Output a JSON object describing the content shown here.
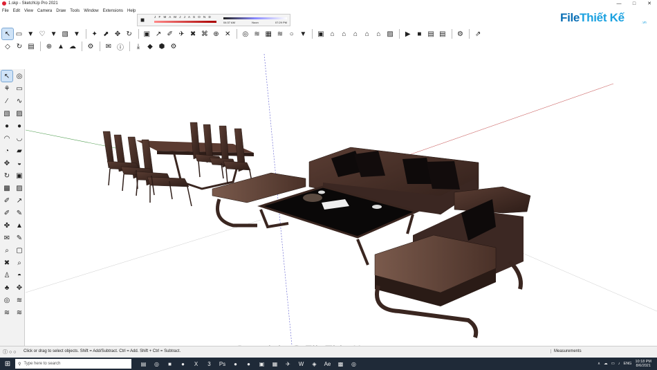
{
  "window": {
    "title": "1.skp - SketchUp Pro 2021",
    "minimize": "—",
    "maximize": "□",
    "close": "✕"
  },
  "menu": [
    "File",
    "Edit",
    "View",
    "Camera",
    "Draw",
    "Tools",
    "Window",
    "Extensions",
    "Help"
  ],
  "shadow": {
    "months": "J F M A M J J A S O N D",
    "time_start": "04:37 AM",
    "time_mid": "Noon",
    "time_end": "07:29 PM"
  },
  "logo": {
    "brand_a": "File",
    "brand_b": "Thiết Kế",
    "suffix": ".vn"
  },
  "toolbar1": [
    "↖",
    "▭",
    "▼",
    "♡",
    "▼",
    "▧",
    "▼",
    "✦",
    "⬈",
    "✥",
    "↻",
    "▣",
    "↗",
    "✐",
    "✈",
    "✖",
    "⌘",
    "⊕",
    "✕",
    "◎",
    "≋",
    "▦",
    "≋",
    "○",
    "▼",
    "▣",
    "⌂",
    "⌂",
    "⌂",
    "⌂",
    "⌂",
    "▨",
    "▶",
    "■",
    "▤",
    "▤",
    "⚙",
    "⇗"
  ],
  "toolbar2": [
    "◇",
    "↻",
    "▤",
    "⊕",
    "▲",
    "☁",
    "⚙",
    "✉",
    "ⓘ",
    "⤓",
    "◆",
    "⬢",
    "⚙"
  ],
  "leftbar": [
    "↖",
    "◎",
    "⚘",
    "▭",
    "∕",
    "∿",
    "▧",
    "▨",
    "●",
    "●",
    "◠",
    "◡",
    "◔",
    "▰",
    "✥",
    "◒",
    "↻",
    "▣",
    "▩",
    "▨",
    "✐",
    "↗",
    "✐",
    "✎",
    "✤",
    "▲",
    "✉",
    "✎",
    "⌕",
    "▢",
    "✖",
    "⌕",
    "♙",
    "◓",
    "♣",
    "✥",
    "◎",
    "≋",
    "≋",
    "≋"
  ],
  "status": {
    "icons": "ⓘ  ○  ○",
    "hint": "Click or drag to select objects. Shift = Add/Subtract. Ctrl = Add. Shift + Ctrl = Subtract.",
    "measurements": "Measurements"
  },
  "watermark": "Copyright © FileThietKe.vn",
  "taskbar": {
    "start": "⊞",
    "search_placeholder": "Type here to search",
    "apps": [
      "▤",
      "◎",
      "■",
      "●",
      "X",
      "3",
      "Ps",
      "●",
      "●",
      "▣",
      "▦",
      "✈",
      "W",
      "◈",
      "Ae",
      "▩",
      "◎"
    ],
    "tray": [
      "∧",
      "☁",
      "▭",
      "♪",
      "ENG"
    ],
    "time": "10:18 PM",
    "date": "8/6/2021"
  }
}
